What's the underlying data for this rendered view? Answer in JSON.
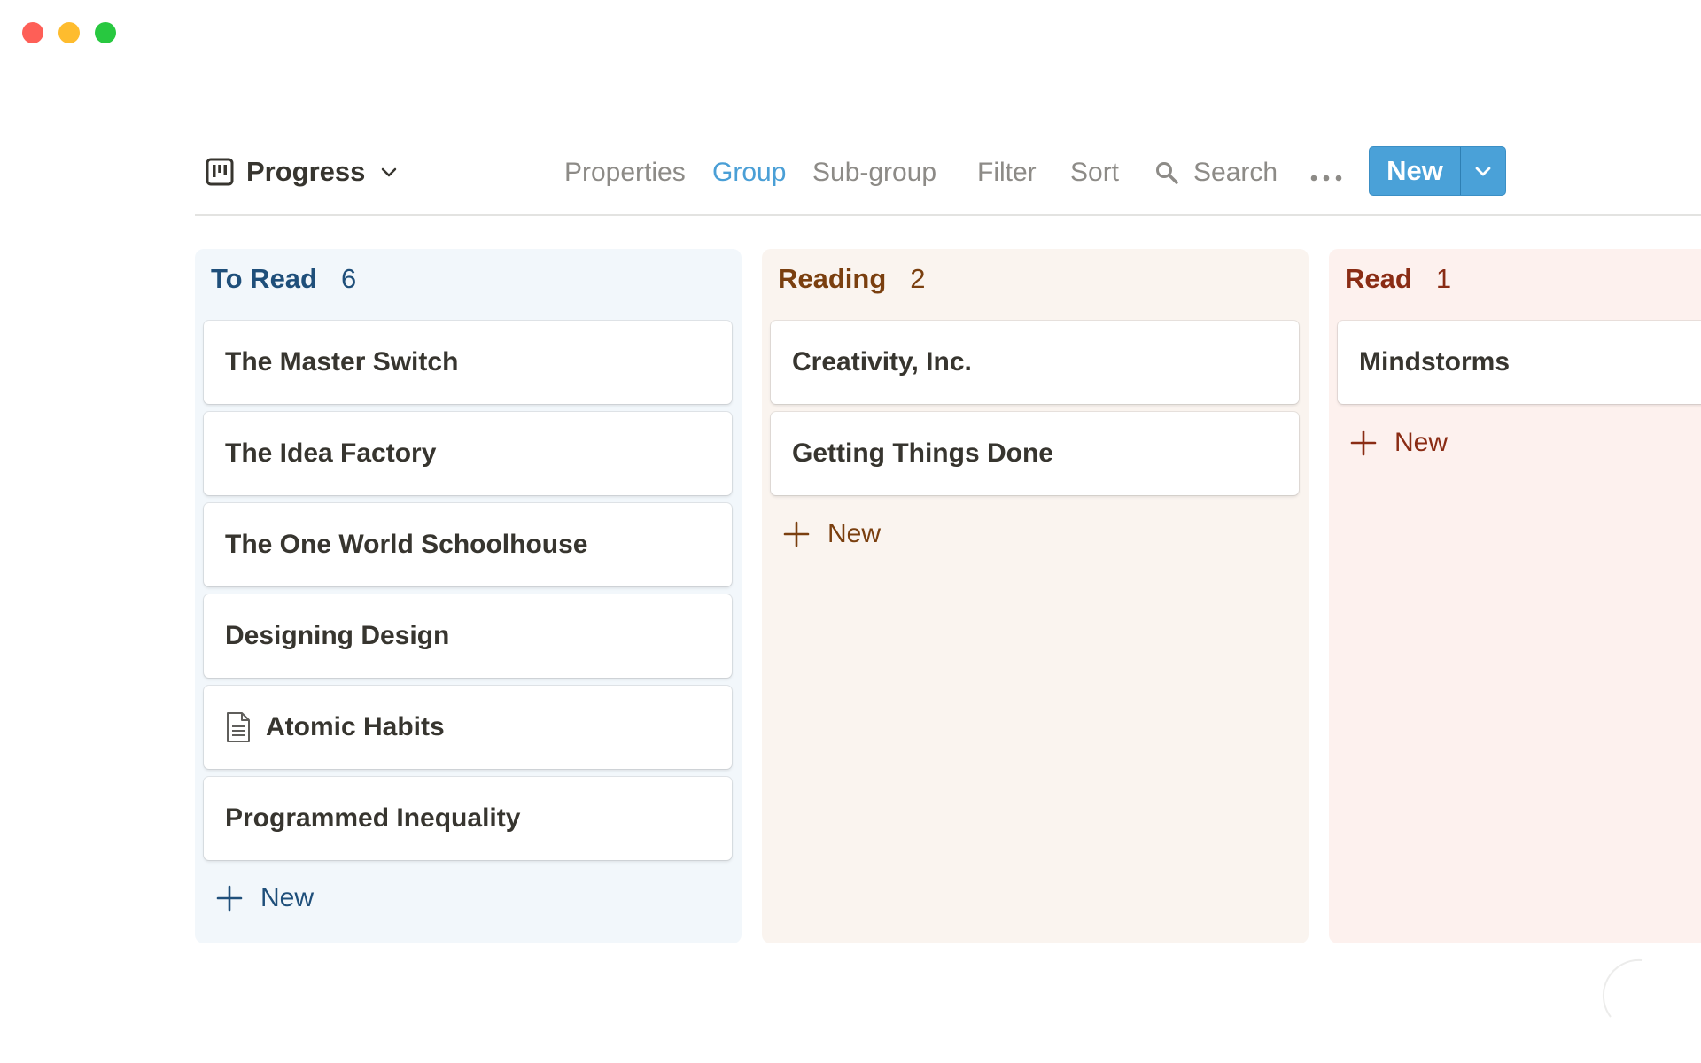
{
  "view": {
    "title": "Progress"
  },
  "toolbar": {
    "properties": "Properties",
    "group": "Group",
    "subgroup": "Sub-group",
    "filter": "Filter",
    "sort": "Sort",
    "search": "Search",
    "new_label": "New"
  },
  "colors": {
    "accent": "#4aa1d8",
    "active_tab": "#4a9fd6"
  },
  "columns": [
    {
      "title": "To Read",
      "count": "6",
      "cards": [
        {
          "title": "The Master Switch"
        },
        {
          "title": "The Idea Factory"
        },
        {
          "title": "The One World Schoolhouse"
        },
        {
          "title": "Designing Design"
        },
        {
          "title": "Atomic Habits",
          "icon": "document-icon"
        },
        {
          "title": "Programmed Inequality"
        }
      ],
      "add_label": "New"
    },
    {
      "title": "Reading",
      "count": "2",
      "cards": [
        {
          "title": "Creativity, Inc."
        },
        {
          "title": "Getting Things Done"
        }
      ],
      "add_label": "New"
    },
    {
      "title": "Read",
      "count": "1",
      "cards": [
        {
          "title": "Mindstorms"
        }
      ],
      "add_label": "New"
    }
  ]
}
